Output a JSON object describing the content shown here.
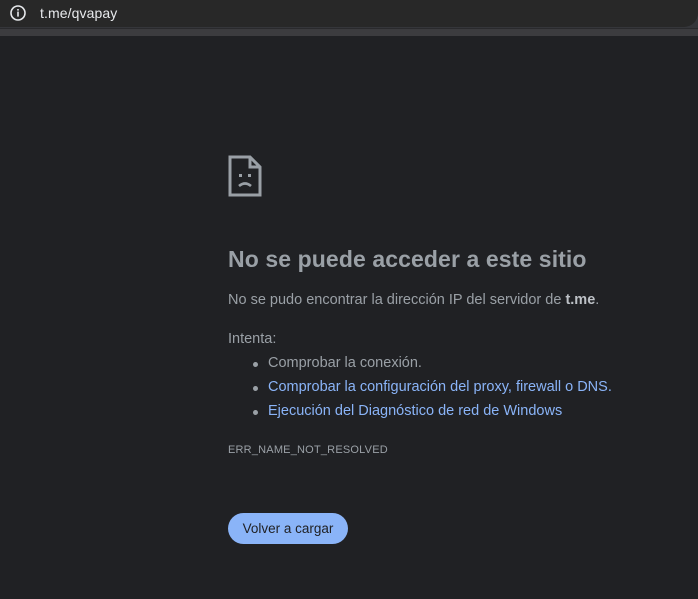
{
  "address_bar": {
    "url": "t.me/qvapay",
    "info_icon": "info-circle-icon"
  },
  "error_page": {
    "icon": "sad-document-icon",
    "headline": "No se puede acceder a este sitio",
    "description_prefix": "No se pudo encontrar la dirección IP del servidor de ",
    "description_host": "t.me",
    "description_suffix": ".",
    "try_label": "Intenta:",
    "suggestions": [
      {
        "text": "Comprobar la conexión.",
        "is_link": false
      },
      {
        "text": "Comprobar la configuración del proxy, firewall o DNS.",
        "is_link": true
      },
      {
        "text": "Ejecución del Diagnóstico de red de Windows",
        "is_link": true
      }
    ],
    "error_code": "ERR_NAME_NOT_RESOLVED",
    "reload_button_label": "Volver a cargar"
  },
  "colors": {
    "background": "#202124",
    "text_secondary": "#9aa0a6",
    "link": "#8ab4f8",
    "button_bg": "#8ab4f8"
  }
}
